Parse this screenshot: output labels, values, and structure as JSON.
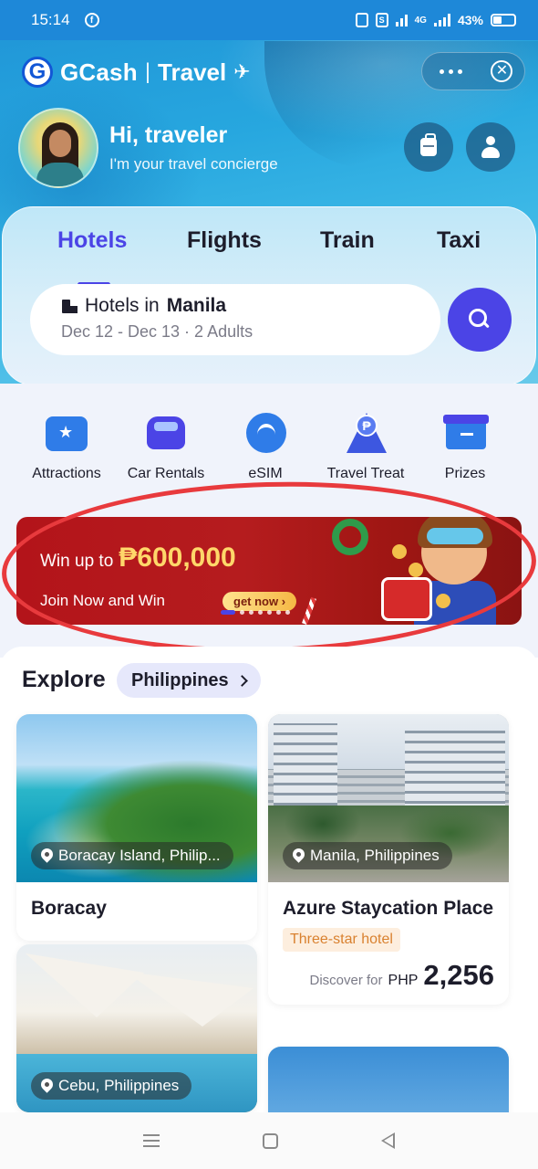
{
  "status_bar": {
    "time": "15:14",
    "network": "4G",
    "battery": "43%"
  },
  "header": {
    "brand": "GCash",
    "separator": "|",
    "product": "Travel",
    "logo_letter": "G"
  },
  "greeting": {
    "title": "Hi, traveler",
    "subtitle": "I'm your travel concierge"
  },
  "tabs": [
    {
      "label": "Hotels",
      "active": true
    },
    {
      "label": "Flights",
      "active": false
    },
    {
      "label": "Train",
      "active": false
    },
    {
      "label": "Taxi",
      "active": false
    }
  ],
  "search": {
    "prefix": "Hotels in",
    "city": "Manila",
    "details": "Dec 12 - Dec 13 · 2 Adults"
  },
  "quick_actions": [
    {
      "label": "Attractions",
      "icon": "ticket-icon"
    },
    {
      "label": "Car Rentals",
      "icon": "car-icon"
    },
    {
      "label": "eSIM",
      "icon": "wifi-icon"
    },
    {
      "label": "Travel Treat",
      "icon": "coin-icon"
    },
    {
      "label": "Prizes",
      "icon": "gift-box-icon"
    }
  ],
  "banner": {
    "headline": "Win up to",
    "amount": "₱600,000",
    "subline": "Join Now and Win",
    "cta": "get now ›"
  },
  "explore": {
    "title": "Explore",
    "country": "Philippines"
  },
  "cards": [
    {
      "location": "Boracay Island, Philip...",
      "title": "Boracay"
    },
    {
      "location": "Manila, Philippines",
      "title": "Azure Staycation Place",
      "badge": "Three-star hotel",
      "price_prefix": "Discover for",
      "currency": "PHP",
      "price": "2,256"
    },
    {
      "location": "Cebu, Philippines"
    },
    {
      "location": ""
    }
  ],
  "colors": {
    "accent": "#4b44e6",
    "annotation": "#e83a3d",
    "banner_bg": "#b3141a"
  }
}
